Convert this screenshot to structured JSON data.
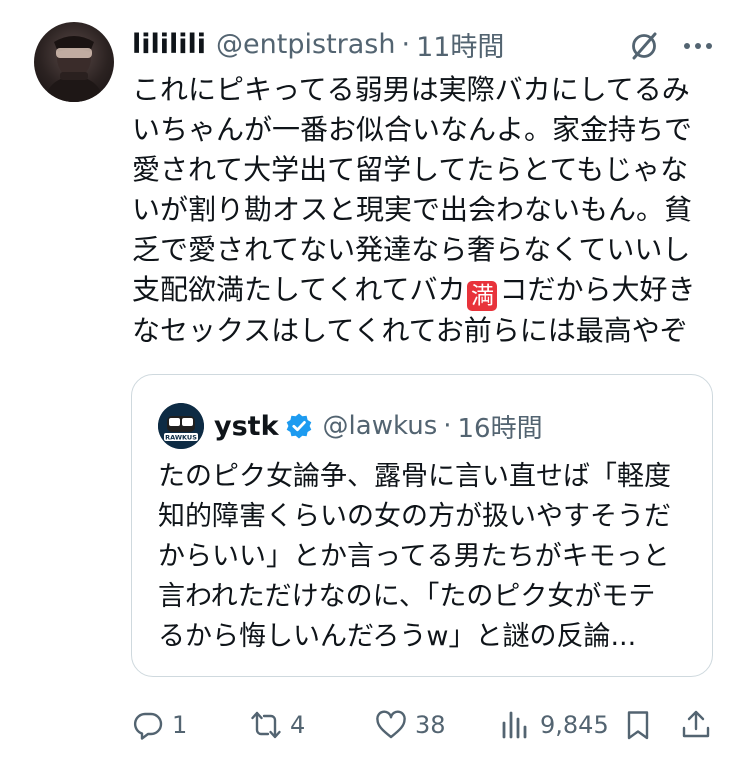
{
  "author": {
    "display_name": "lililili",
    "handle": "@entpistrash",
    "separator": "·",
    "time": "11時間"
  },
  "tweet": {
    "text_before_emoji": "これにピキってる弱男は実際バカにしてるみ\nいちゃんが一番お似合いなんよ。家金持ちで\n愛されて大学出て留学してたらとてもじゃな\nいが割り勘オスと現実で出会わないもん。貧\n乏で愛されてない発達なら奢らなくていいし\n支配欲満たしてくれてバカ",
    "emoji": "満",
    "text_after_emoji": "コだから大好き\nなセックスはしてくれてお前らには最高やぞ"
  },
  "quote": {
    "display_name": "ystk",
    "avatar_text": "RAWKUS",
    "handle": "@lawkus",
    "separator": "·",
    "time": "16時間",
    "text": "たのピク女論争、露骨に言い直せば「軽度\n知的障害くらいの女の方が扱いやすそうだ\nからいい」とか言ってる男たちがキモっと\n言われただけなのに、「たのピク女がモテ\nるから悔しいんだろうw」と謎の反論..."
  },
  "actions": {
    "replies": "1",
    "reposts": "4",
    "likes": "38",
    "views": "9,845"
  },
  "colors": {
    "text": "#0f1419",
    "secondary": "#536471",
    "border": "#cfd9de",
    "verified": "#1d9bf0",
    "emoji_bg": "#e8333b"
  }
}
